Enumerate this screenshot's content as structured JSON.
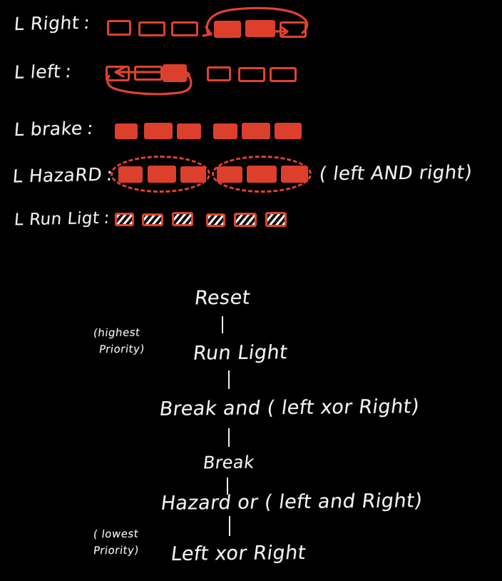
{
  "meta": {
    "background_color": "#000000",
    "ink_white": "#f2f2f0",
    "ink_red": "#e0422f",
    "lamp_on_fill": "#dd3f2d"
  },
  "signal_rows": [
    {
      "id": "right",
      "label": "L Right",
      "separator": ":",
      "lamps": [
        "off",
        "off",
        "off",
        "on",
        "on",
        "on"
      ],
      "annotation": "sweep-arrow-left-to-right",
      "group": null
    },
    {
      "id": "left",
      "label": "L left",
      "separator": ":",
      "lamps": [
        "off",
        "off",
        "on",
        "off",
        "off",
        "off"
      ],
      "annotation": "sweep-arrow-right-to-left",
      "group": null
    },
    {
      "id": "brake",
      "label": "L brake",
      "separator": ":",
      "lamps": [
        "on",
        "on",
        "on",
        "on",
        "on",
        "on"
      ],
      "annotation": null,
      "group": null
    },
    {
      "id": "hazard",
      "label": "L HazaRD",
      "separator": ":",
      "lamps": [
        "on",
        "on",
        "on",
        "on",
        "on",
        "on"
      ],
      "annotation": "two-dashed-ovals",
      "group": "dashed",
      "note_parts": [
        {
          "text": "( left ",
          "color": "white"
        },
        {
          "text": "AND",
          "color": "red"
        },
        {
          "text": " right)",
          "color": "white"
        }
      ]
    },
    {
      "id": "runlight",
      "label": "L Run Ligt",
      "separator": ":",
      "lamps": [
        "hatch",
        "hatch",
        "hatch",
        "hatch",
        "hatch",
        "hatch"
      ],
      "annotation": null,
      "group": null
    }
  ],
  "priority_tree": {
    "highest_note": "(highest\nPriority)",
    "highest_note_line1": "(highest",
    "highest_note_line2": "Priority)",
    "lowest_note_line1": "( lowest",
    "lowest_note_line2": "Priority)",
    "levels": [
      {
        "id": "reset",
        "parts": [
          {
            "text": "Reset",
            "color": "white"
          }
        ]
      },
      {
        "id": "run-light",
        "parts": [
          {
            "text": "Run Light",
            "color": "white"
          }
        ]
      },
      {
        "id": "brake-and-left-xor-right",
        "parts": [
          {
            "text": "Break ",
            "color": "white"
          },
          {
            "text": "and",
            "color": "red"
          },
          {
            "text": " ( left ",
            "color": "white"
          },
          {
            "text": "xor",
            "color": "red"
          },
          {
            "text": "  Right)",
            "color": "white"
          }
        ]
      },
      {
        "id": "brake",
        "parts": [
          {
            "text": "Break",
            "color": "white"
          }
        ]
      },
      {
        "id": "hazard-or-left-and-right",
        "parts": [
          {
            "text": "Hazard ",
            "color": "white"
          },
          {
            "text": "or",
            "color": "red"
          },
          {
            "text": " ( left ",
            "color": "white"
          },
          {
            "text": "and",
            "color": "red"
          },
          {
            "text": " Right)",
            "color": "white"
          }
        ]
      },
      {
        "id": "left-xor-right",
        "parts": [
          {
            "text": "Left ",
            "color": "white"
          },
          {
            "text": "xor",
            "color": "red"
          },
          {
            "text": " Right",
            "color": "white"
          }
        ]
      }
    ]
  }
}
